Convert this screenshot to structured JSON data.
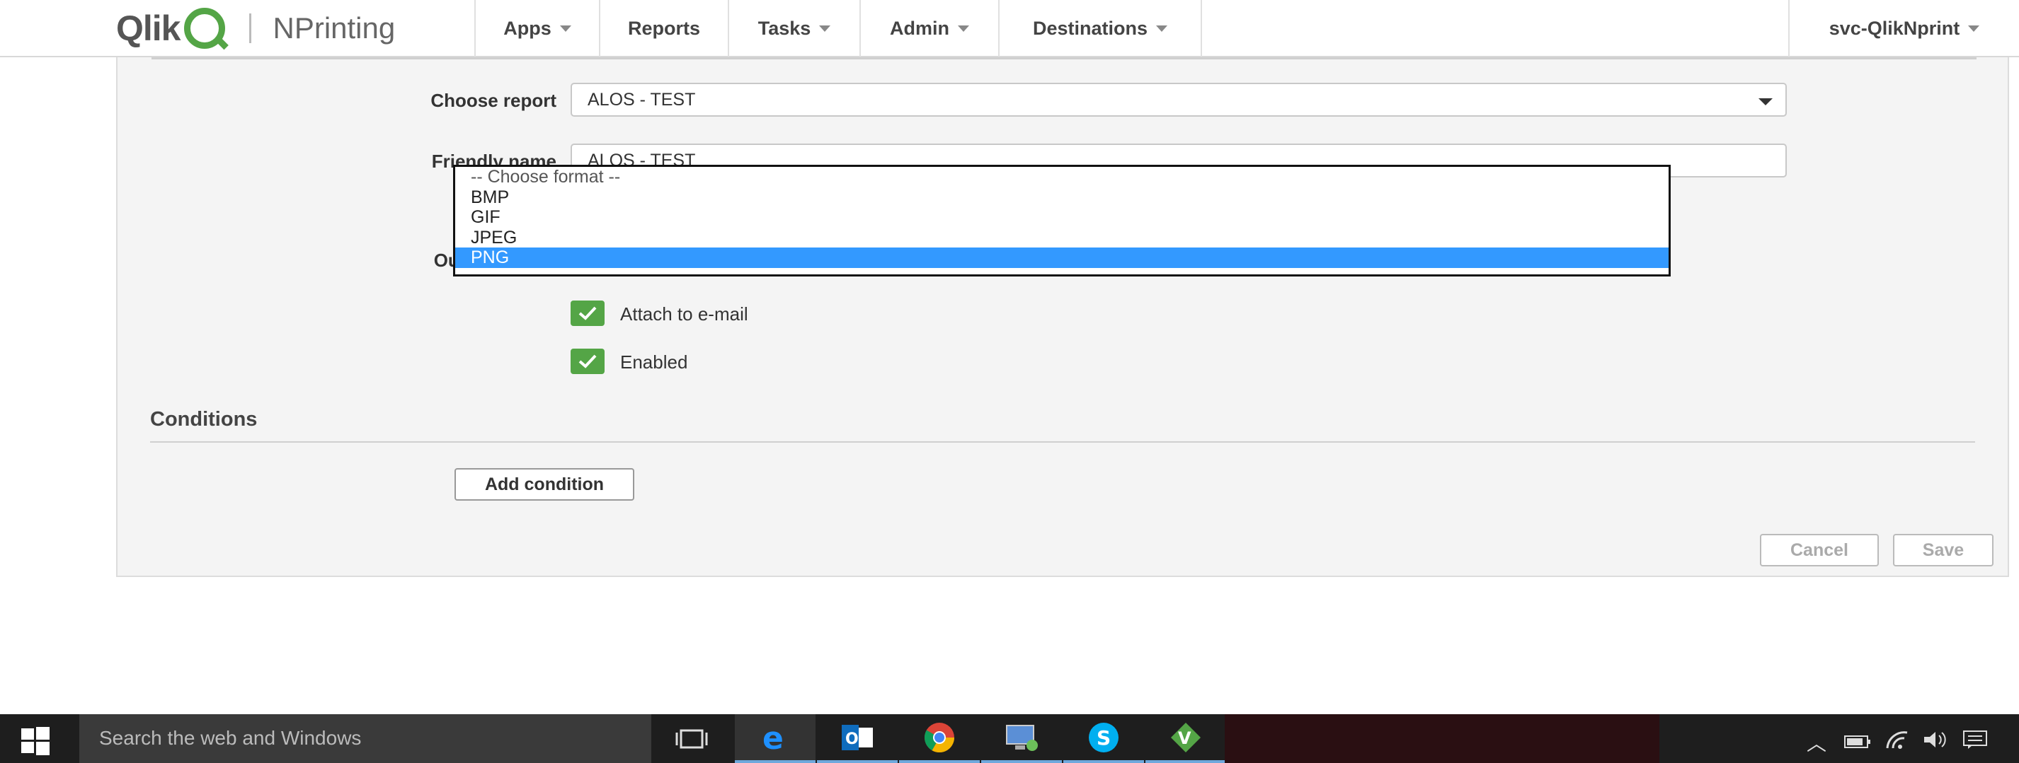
{
  "brand": {
    "logo_text": "Qlik",
    "product": "NPrinting"
  },
  "nav": {
    "apps": "Apps",
    "reports": "Reports",
    "tasks": "Tasks",
    "admin": "Admin",
    "destinations": "Destinations",
    "user": "svc-QlikNprint"
  },
  "form": {
    "choose_report_label": "Choose report",
    "choose_report_value": "ALOS - TEST",
    "friendly_name_label": "Friendly name",
    "friendly_name_value": "ALOS - TEST",
    "output_format_label": "Output format",
    "format_options": [
      "-- Choose format --",
      "BMP",
      "GIF",
      "JPEG",
      "PNG"
    ],
    "selected_format": "PNG",
    "attach_email_label": "Attach to e-mail",
    "attach_email_checked": true,
    "enabled_label": "Enabled",
    "enabled_checked": true
  },
  "conditions": {
    "title": "Conditions",
    "add_button": "Add condition"
  },
  "actions": {
    "cancel": "Cancel",
    "save": "Save"
  },
  "taskbar": {
    "search_placeholder": "Search the web and Windows",
    "apps": [
      "task-view-icon",
      "edge-icon",
      "outlook-icon",
      "chrome-icon",
      "remote-desktop-icon",
      "skype-icon",
      "vim-icon"
    ]
  },
  "colors": {
    "accent_green": "#54a546",
    "selected_blue": "#3399ff"
  }
}
